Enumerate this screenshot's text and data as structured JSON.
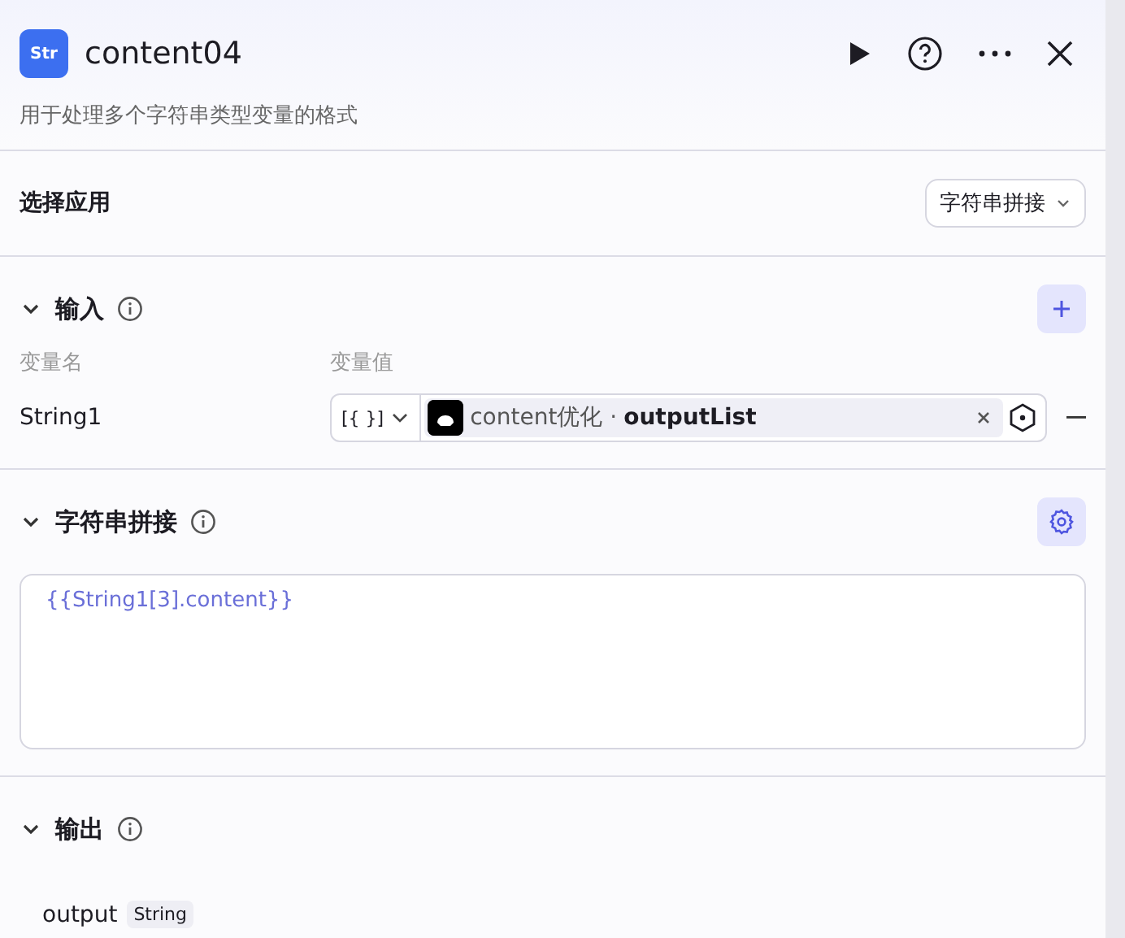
{
  "node": {
    "icon_label": "Str",
    "title": "content04",
    "description": "用于处理多个字符串类型变量的格式"
  },
  "app_select": {
    "label": "选择应用",
    "value": "字符串拼接"
  },
  "input": {
    "title": "输入",
    "expanded": true,
    "columns": [
      "变量名",
      "变量值"
    ],
    "rows": [
      {
        "name": "String1",
        "type_glyph": "[{ }]",
        "source": "content优化",
        "separator": "·",
        "field": "outputList"
      }
    ]
  },
  "concat": {
    "title": "字符串拼接",
    "expanded": true,
    "template": "{{String1[3].content}}"
  },
  "output": {
    "title": "输出",
    "expanded": true,
    "items": [
      {
        "name": "output",
        "type": "String"
      }
    ]
  }
}
